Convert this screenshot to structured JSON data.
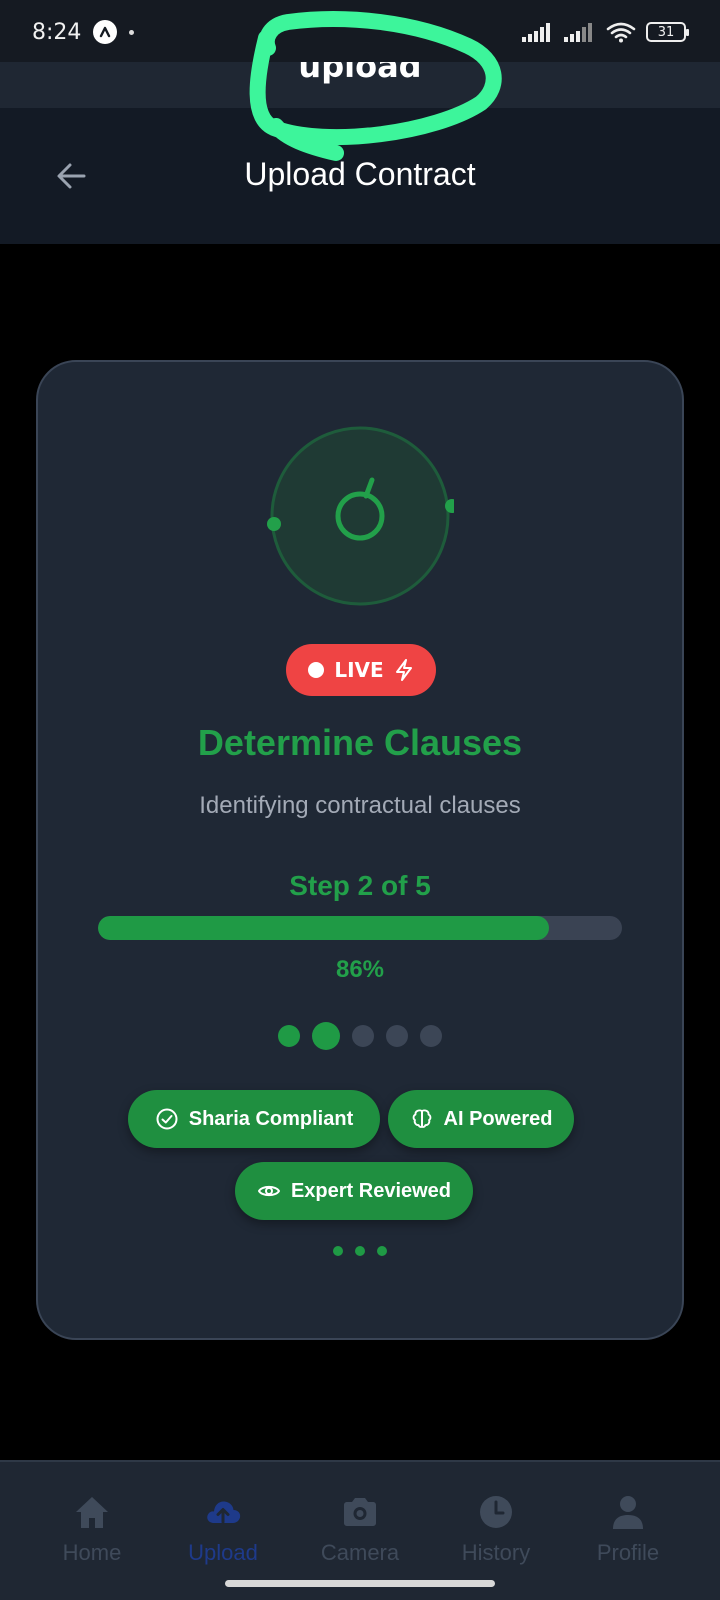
{
  "status_bar": {
    "time": "8:24",
    "battery": "31"
  },
  "underlying_header": {
    "text": "upload"
  },
  "header": {
    "title": "Upload Contract"
  },
  "card": {
    "live_label": "LIVE",
    "step_title": "Determine Clauses",
    "step_description": "Identifying contractual clauses",
    "step_count": "Step 2 of 5",
    "progress_percent_label": "86%",
    "progress_value": 0.86,
    "step_indicator": {
      "total": 5,
      "current": 2
    },
    "chips": [
      {
        "label": "Sharia Compliant",
        "icon": "check-circle-icon"
      },
      {
        "label": "AI Powered",
        "icon": "brain-icon"
      },
      {
        "label": "Expert Reviewed",
        "icon": "eye-icon"
      }
    ]
  },
  "bottom_nav": {
    "items": [
      {
        "label": "Home",
        "icon": "home-icon",
        "active": false
      },
      {
        "label": "Upload",
        "icon": "cloud-upload-icon",
        "active": true
      },
      {
        "label": "Camera",
        "icon": "camera-icon",
        "active": false
      },
      {
        "label": "History",
        "icon": "clock-icon",
        "active": false
      },
      {
        "label": "Profile",
        "icon": "user-icon",
        "active": false
      }
    ]
  },
  "colors": {
    "accent_green": "#22a04a",
    "live_red": "#ef4444",
    "card_bg": "#1f2835",
    "nav_active": "#1e3a8a",
    "scribble_green": "#3df59b"
  }
}
